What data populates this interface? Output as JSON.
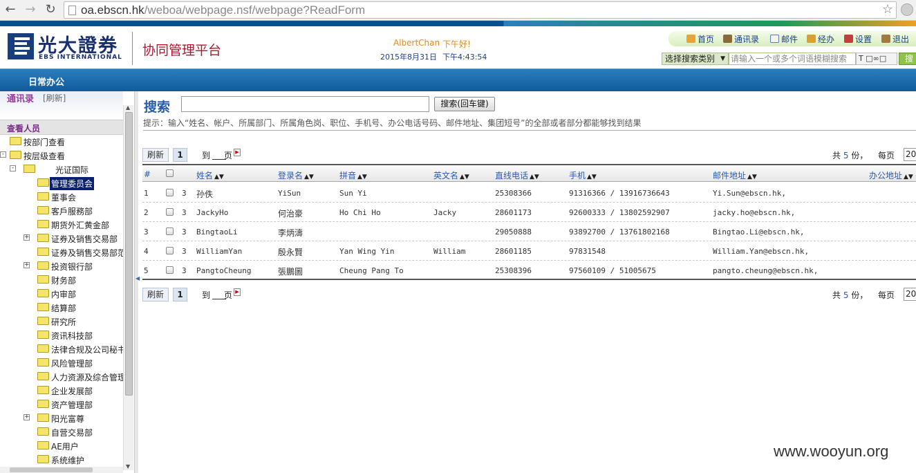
{
  "browser": {
    "url_host": "oa.ebscn.hk",
    "url_path": "/weboa/webpage.nsf/webpage?ReadForm"
  },
  "header": {
    "logo_cn": "光大證券",
    "logo_en": "EBS INTERNATIONAL",
    "platform_title": "协同管理平台",
    "user_name": "AlbertChan",
    "greeting": "下午好!",
    "date": "2015年8月31日",
    "time": "下午4:43:54",
    "links": [
      "首页",
      "通讯录",
      "邮件",
      "经办",
      "设置",
      "退出"
    ],
    "search_category": "选择搜索类别",
    "search_placeholder": "请输入一个或多个词语模糊搜索",
    "search_tools": "T",
    "search_button": "搜"
  },
  "navbar": {
    "label": "日常办公"
  },
  "sidebar": {
    "title": "通讯录",
    "refresh": "[刷新]",
    "view_label": "查看人员",
    "tree": [
      {
        "label": "按部门查看",
        "level": 0,
        "expander": ""
      },
      {
        "label": "按层级查看",
        "level": 0,
        "expander": "-"
      },
      {
        "label": "光证国际",
        "level": 1,
        "expander": "-"
      },
      {
        "label": "管理委员会",
        "level": 2,
        "expander": "",
        "selected": true
      },
      {
        "label": "董事会",
        "level": 2,
        "expander": ""
      },
      {
        "label": "客戶服務部",
        "level": 2,
        "expander": ""
      },
      {
        "label": "期货外汇黄金部",
        "level": 2,
        "expander": ""
      },
      {
        "label": "证券及销售交易部",
        "level": 2,
        "expander": "+"
      },
      {
        "label": "证券及销售交易部范",
        "level": 2,
        "expander": ""
      },
      {
        "label": "投资银行部",
        "level": 2,
        "expander": "+"
      },
      {
        "label": "财务部",
        "level": 2,
        "expander": ""
      },
      {
        "label": "内审部",
        "level": 2,
        "expander": ""
      },
      {
        "label": "结算部",
        "level": 2,
        "expander": ""
      },
      {
        "label": "研究所",
        "level": 2,
        "expander": ""
      },
      {
        "label": "资讯科技部",
        "level": 2,
        "expander": ""
      },
      {
        "label": "法律合规及公司秘书",
        "level": 2,
        "expander": ""
      },
      {
        "label": "风险管理部",
        "level": 2,
        "expander": ""
      },
      {
        "label": "人力资源及综合管理",
        "level": 2,
        "expander": ""
      },
      {
        "label": "企业发展部",
        "level": 2,
        "expander": ""
      },
      {
        "label": "资产管理部",
        "level": 2,
        "expander": ""
      },
      {
        "label": "阳光富尊",
        "level": 2,
        "expander": "+"
      },
      {
        "label": "自营交易部",
        "level": 2,
        "expander": ""
      },
      {
        "label": "AE用户",
        "level": 2,
        "expander": ""
      },
      {
        "label": "系统维护",
        "level": 2,
        "expander": ""
      }
    ]
  },
  "main": {
    "search_label": "搜索",
    "search_value": "",
    "search_button": "搜索(回车键)",
    "hint": "提示：输入“姓名、帐户、所属部门、所属角色岗、职位、手机号、办公电话号码、邮件地址、集团短号”的全部或者部分都能够找到结果",
    "pager": {
      "refresh": "刷新",
      "page": "1",
      "goto": "到",
      "page_unit": "页",
      "total_prefix": "共",
      "total": "5",
      "total_suffix": "份，",
      "per_page_label": "每页",
      "per_page": "20"
    },
    "columns": [
      "#",
      "姓名",
      "登录名",
      "拼音",
      "英文名",
      "直线电话",
      "手机",
      "邮件地址",
      "办公地址"
    ],
    "rows": [
      {
        "num": "1",
        "level": "3",
        "name": "孙佚",
        "login": "YiSun",
        "pinyin": "Sun Yi",
        "english": "",
        "direct": "25308366",
        "mobile": "91316366 / 13916736643",
        "email": "Yi.Sun@ebscn.hk,"
      },
      {
        "num": "2",
        "level": "3",
        "name": "JackyHo",
        "login": "何治豪",
        "pinyin": "Ho Chi Ho",
        "english": "Jacky",
        "direct": "28601173",
        "mobile": "92600333 / 13802592907",
        "email": "jacky.ho@ebscn.hk,"
      },
      {
        "num": "3",
        "level": "3",
        "name": "BingtaoLi",
        "login": "李炳濤",
        "pinyin": "",
        "english": "",
        "direct": "29050888",
        "mobile": "93892700 / 13761802168",
        "email": "Bingtao.Li@ebscn.hk,"
      },
      {
        "num": "4",
        "level": "3",
        "name": "WilliamYan",
        "login": "殷永賢",
        "pinyin": "Yan Wing Yin",
        "english": "William",
        "direct": "28601185",
        "mobile": "97831548",
        "email": "William.Yan@ebscn.hk,"
      },
      {
        "num": "5",
        "level": "3",
        "name": "PangtoCheung",
        "login": "張鵬圖",
        "pinyin": "Cheung Pang To",
        "english": "",
        "direct": "25308396",
        "mobile": "97560109 / 51005675",
        "email": "pangto.cheung@ebscn.hk,"
      }
    ]
  },
  "watermark": "www.wooyun.org"
}
